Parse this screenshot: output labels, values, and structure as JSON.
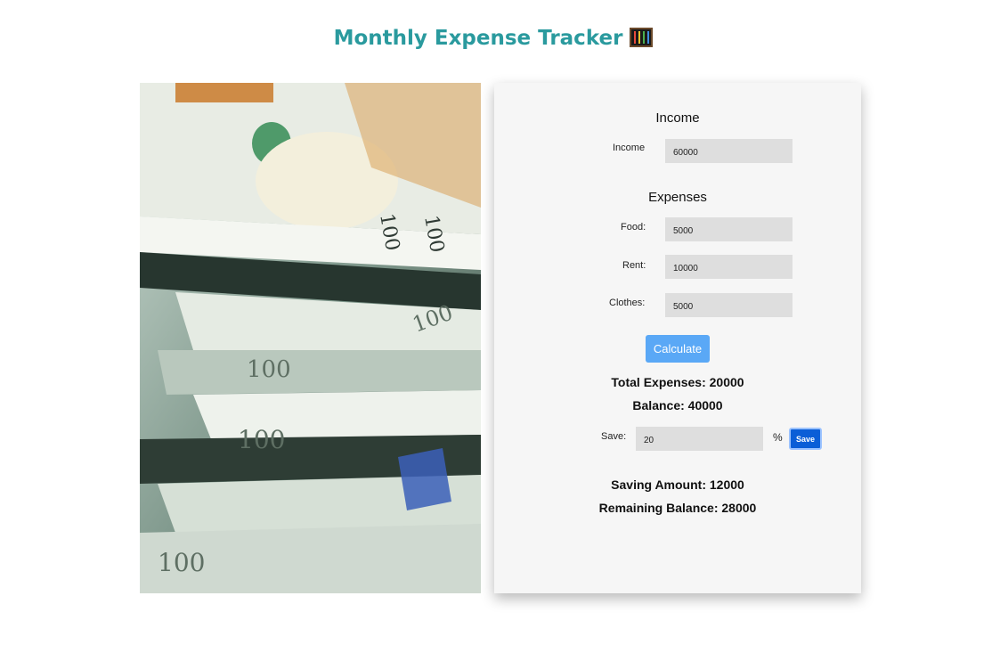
{
  "header": {
    "title": "Monthly Expense Tracker",
    "emoji_icon": "abacus-icon"
  },
  "image": {
    "description_icon": "money-photo"
  },
  "income": {
    "section_title": "Income",
    "label": "Income",
    "value": "60000"
  },
  "expenses": {
    "section_title": "Expenses",
    "food_label": "Food:",
    "food_value": "5000",
    "rent_label": "Rent:",
    "rent_value": "10000",
    "clothes_label": "Clothes:",
    "clothes_value": "5000"
  },
  "calculate_label": "Calculate",
  "results": {
    "total_expenses": "Total Expenses: 20000",
    "balance": "Balance: 40000"
  },
  "save": {
    "label": "Save:",
    "value": "20",
    "percent_sign": "%",
    "button_label": "Save"
  },
  "savings": {
    "saving_amount": "Saving Amount: 12000",
    "remaining_balance": "Remaining Balance: 28000"
  },
  "colors": {
    "title": "#2a9a9e",
    "calculate": "#5aa8f6",
    "save_button": "#0b5ed7",
    "panel": "#f6f6f6",
    "field": "#dedede"
  }
}
